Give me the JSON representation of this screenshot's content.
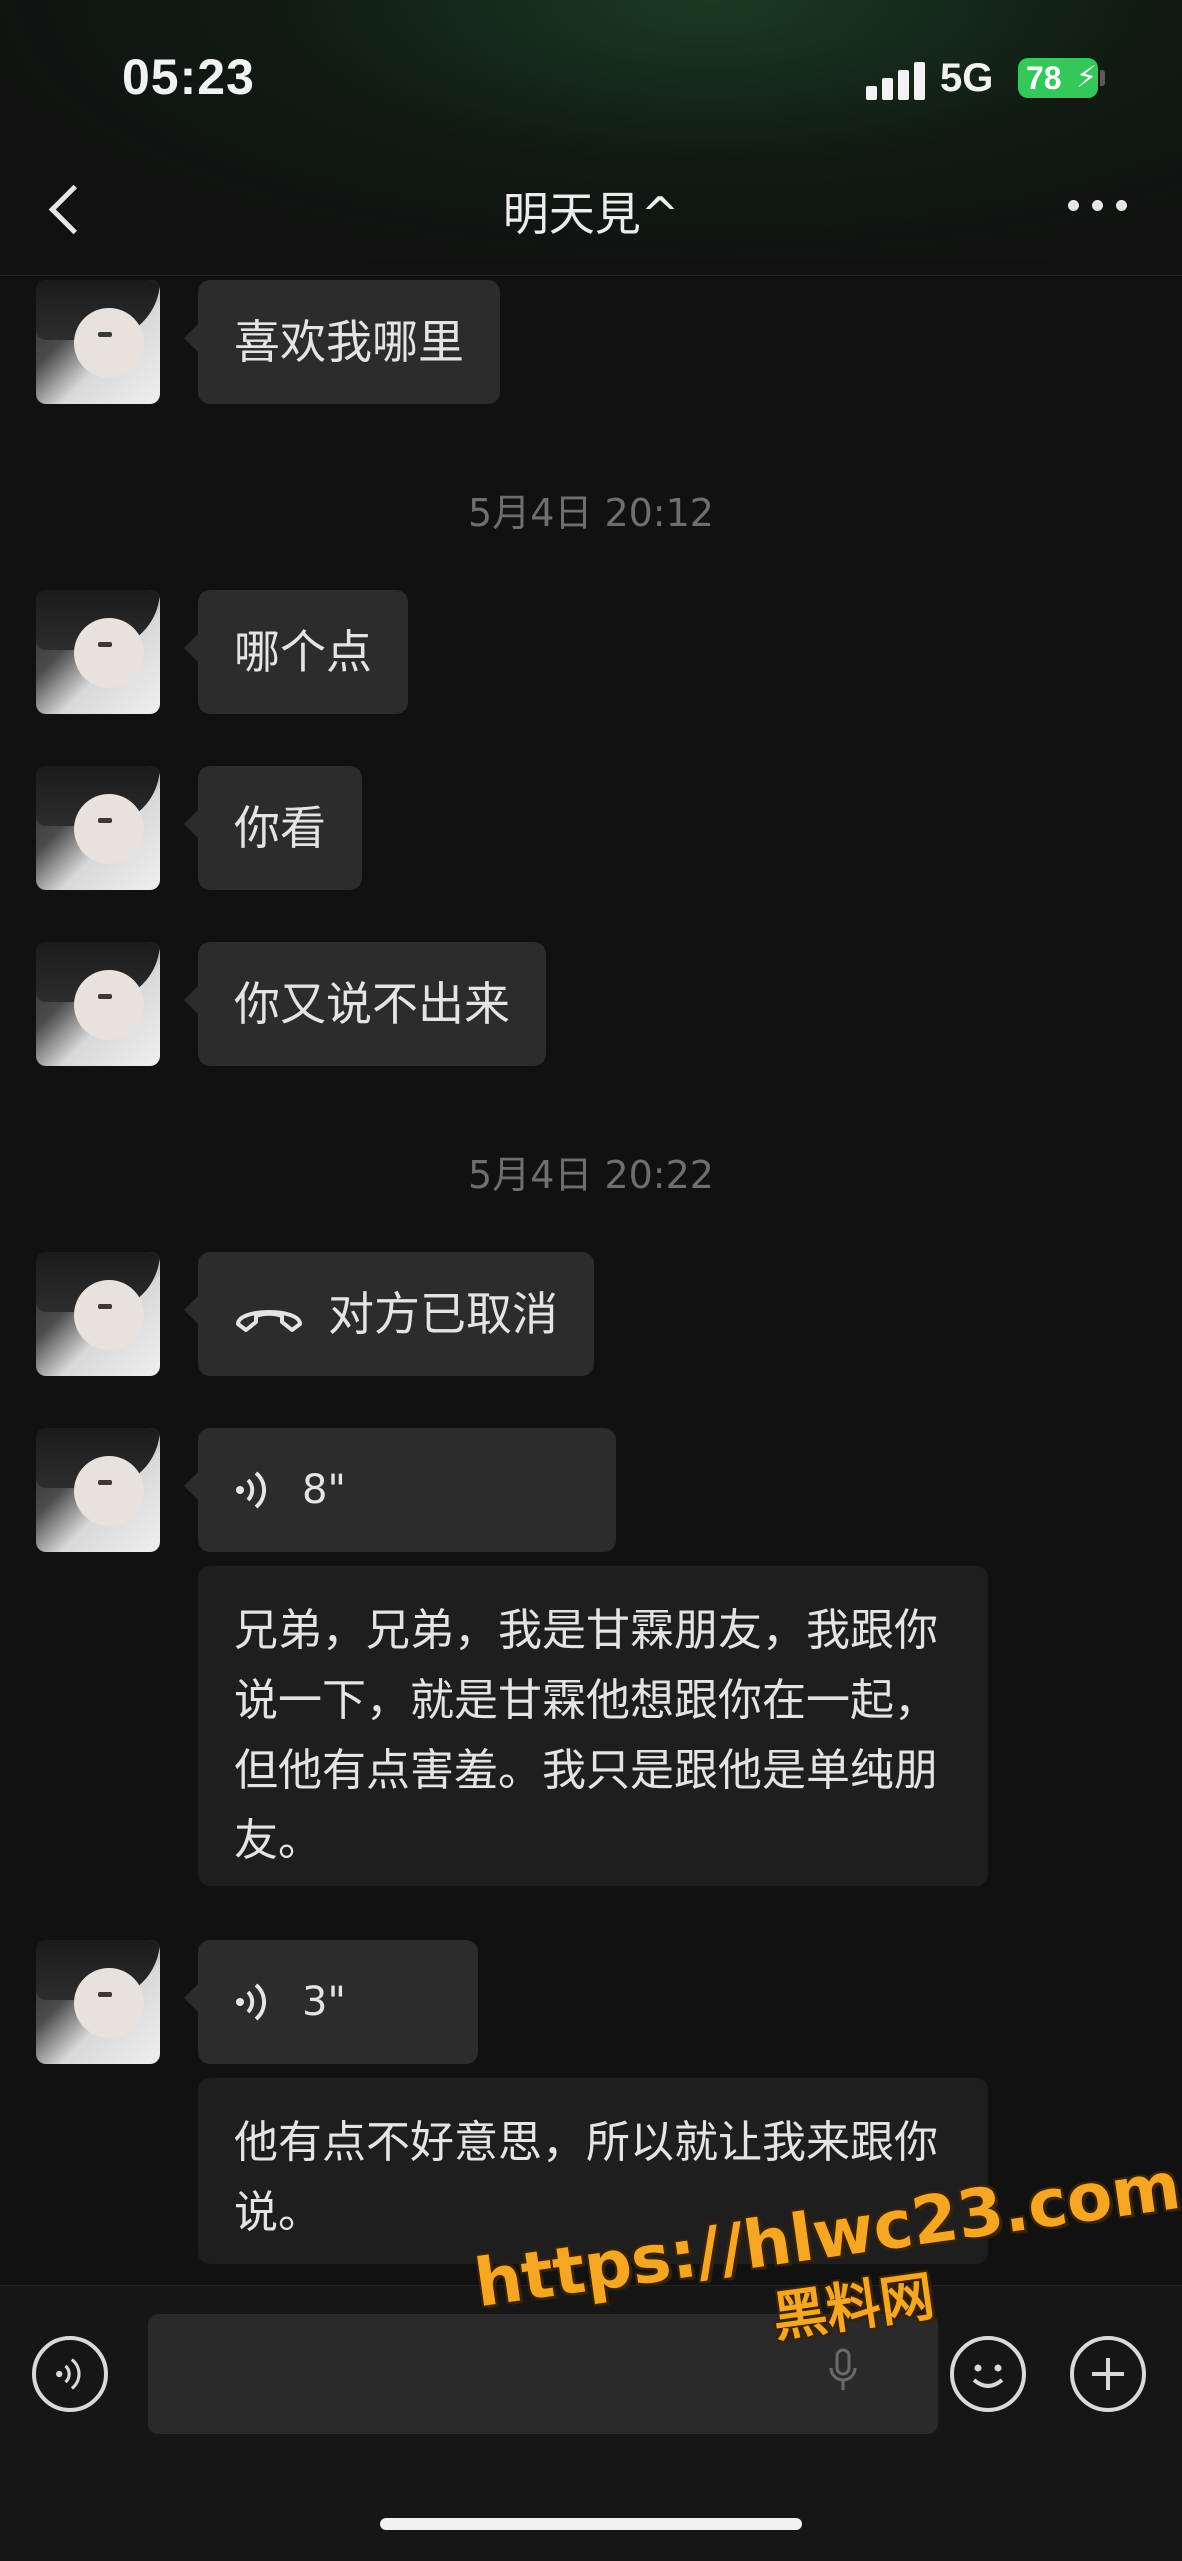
{
  "status_bar": {
    "time": "05:23",
    "network": "5G",
    "battery": "78"
  },
  "nav": {
    "title": "明天見^"
  },
  "messages": {
    "m1": {
      "text": "喜欢我哪里"
    },
    "ts1": "5月4日 20:12",
    "m2": {
      "text": "哪个点"
    },
    "m3": {
      "text": "你看"
    },
    "m4": {
      "text": "你又说不出来"
    },
    "ts2": "5月4日 20:22",
    "m5": {
      "text": "对方已取消"
    },
    "m6": {
      "duration": "8\"",
      "transcript": "兄弟，兄弟，我是甘霖朋友，我跟你说一下，就是甘霖他想跟你在一起，但他有点害羞。我只是跟他是单纯朋友。"
    },
    "m7": {
      "duration": "3\"",
      "transcript": "他有点不好意思，所以就让我来跟你说。"
    }
  },
  "watermark": {
    "url": "https://hlwc23.com",
    "label": "黑料网"
  },
  "colors": {
    "battery": "#34c759",
    "bubble": "#2c2c2c",
    "watermark": "#f5a623"
  }
}
